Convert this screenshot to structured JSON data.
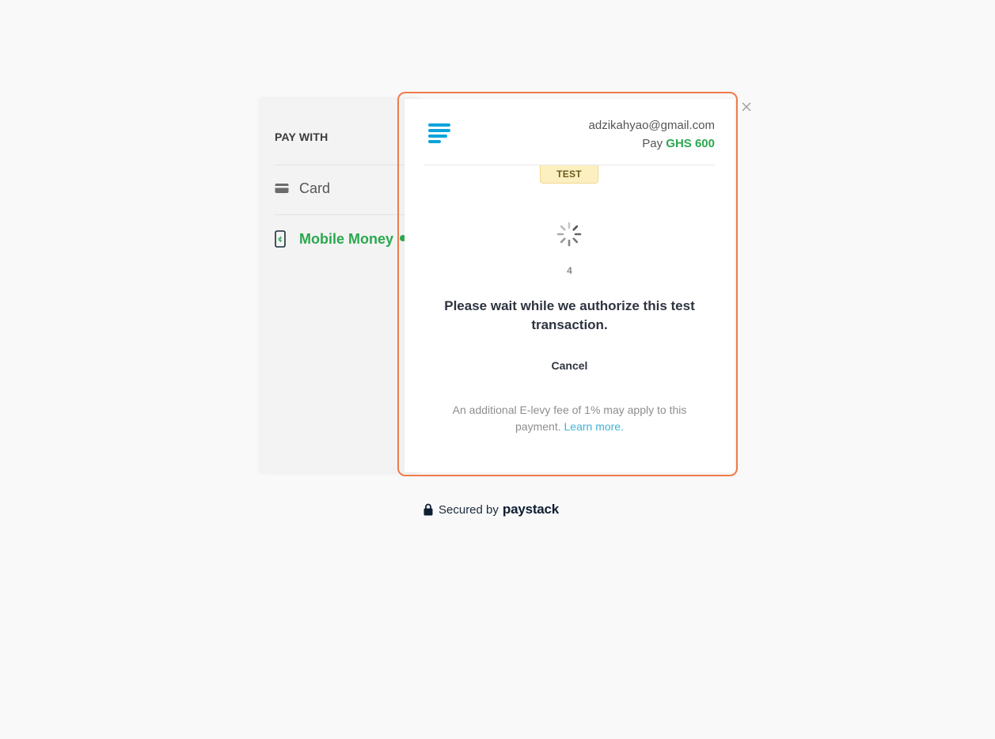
{
  "pay_with": {
    "title": "PAY WITH",
    "methods": [
      {
        "label": "Card",
        "icon": "credit-card-icon",
        "active": false
      },
      {
        "label": "Mobile Money",
        "icon": "mobile-money-icon",
        "active": true
      }
    ]
  },
  "modal": {
    "email": "adzikahyao@gmail.com",
    "pay_prefix": "Pay",
    "amount": "GHS 600",
    "badge": "TEST",
    "countdown": "4",
    "message": "Please wait while we authorize this test transaction.",
    "cancel_label": "Cancel",
    "levy_text": "An additional E-levy fee of 1% may apply to this payment.",
    "learn_more": "Learn more."
  },
  "footer": {
    "secured_by": "Secured by",
    "brand": "paystack"
  },
  "colors": {
    "accent_green": "#2aa84f",
    "outline_orange": "#f07b4a",
    "logo_blue": "#0ba4db",
    "link_blue": "#3fb3d6"
  }
}
